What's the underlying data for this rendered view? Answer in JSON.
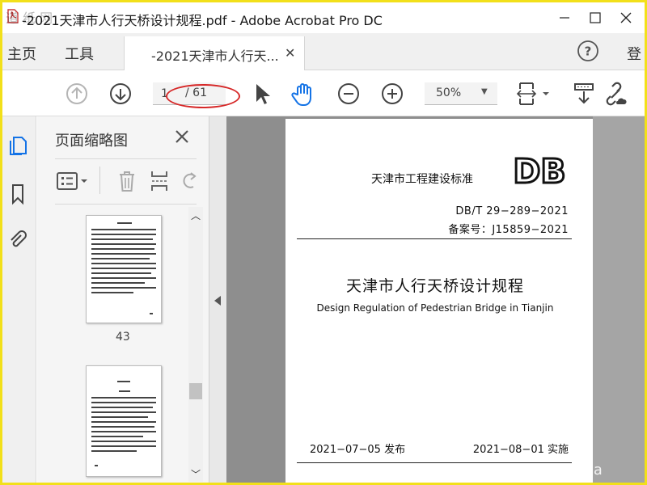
{
  "window": {
    "title": "-2021天津市人行天桥设计规程.pdf - Adobe Acrobat Pro DC"
  },
  "menubar": {
    "home": "主页",
    "tools": "工具",
    "doc_tab": "-2021天津市人行天...",
    "sign_in": "登"
  },
  "toolbar": {
    "current_page": "1",
    "total_pages": "/ 61",
    "zoom": "50%"
  },
  "thumbnails_panel": {
    "title": "页面缩略图",
    "pages": [
      {
        "number": "43"
      },
      {
        "number": ""
      }
    ]
  },
  "document": {
    "org": "天津市工程建设标准",
    "logo": "DB",
    "standard_number": "DB/T 29−289−2021",
    "record_number": "备案号：J15859−2021",
    "title_cn": "天津市人行天桥设计规程",
    "title_en": "Design Regulation of Pedestrian Bridge in Tianjin",
    "publish_date": "2021−07−05 发布",
    "implement_date": "2021−08−01 实施"
  },
  "watermarks": {
    "top_left": "道 纸 网",
    "bottom_right": "www.cnda"
  },
  "colors": {
    "frame": "#f2e01a",
    "accent_blue": "#1473e6",
    "annotation_red": "#d62828"
  }
}
